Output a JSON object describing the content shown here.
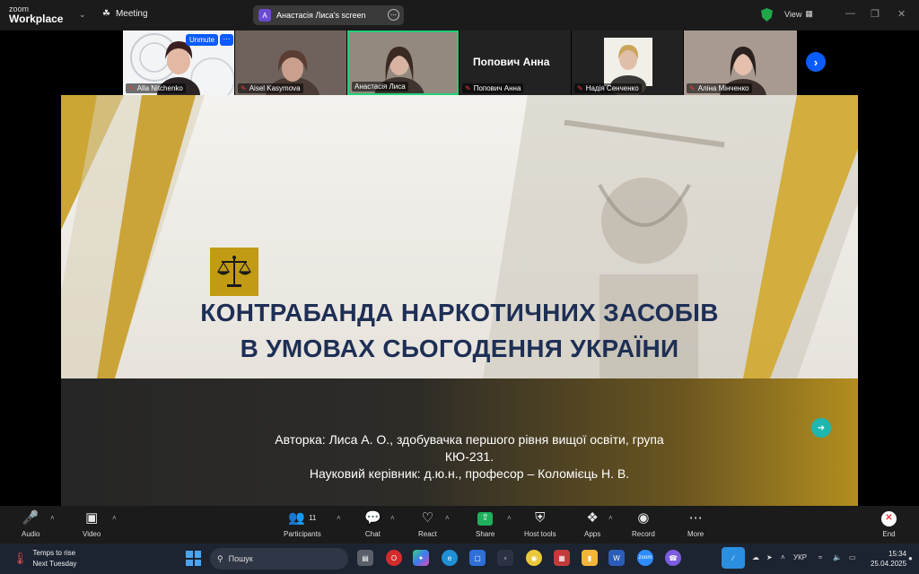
{
  "app": {
    "logo_line1": "zoom",
    "logo_line2": "Workplace",
    "meeting_label": "Meeting"
  },
  "screen_share": {
    "avatar_letter": "A",
    "label": "Анастасія Лиса's screen"
  },
  "view_label": "View",
  "gallery": {
    "participants": [
      {
        "name": "Alla Nitchenko",
        "muted": true,
        "unmute_label": "Unmute"
      },
      {
        "name": "Aisel Kasymova",
        "muted": true
      },
      {
        "name": "Анастасія Лиса",
        "muted": false,
        "active_speaker": true
      },
      {
        "name": "Попович Анна",
        "muted": true,
        "display_name_large": "Попович Анна"
      },
      {
        "name": "Надія Сенченко",
        "muted": true
      },
      {
        "name": "Аліна Мінченко",
        "muted": true
      }
    ]
  },
  "slide": {
    "title_line1": "КОНТРАБАНДА НАРКОТИЧНИХ ЗАСОБІВ",
    "title_line2": "В УМОВАХ СЬОГОДЕННЯ УКРАЇНИ",
    "body_line1": "Авторка: Лиса А. О., здобувачка першого рівня вищої освіти, група",
    "body_line2": "КЮ-231.",
    "body_line3": "Науковий керівник: д.ю.н., професор – Коломієць Н. В.",
    "accent_color": "#c29b14",
    "title_color": "#1e2f55"
  },
  "controls": {
    "audio": "Audio",
    "video": "Video",
    "participants": "Participants",
    "participants_count": "11",
    "chat": "Chat",
    "react": "React",
    "share": "Share",
    "host_tools": "Host tools",
    "apps": "Apps",
    "record": "Record",
    "more": "More",
    "end": "End"
  },
  "taskbar": {
    "weather_line1": "Temps to rise",
    "weather_line2": "Next Tuesday",
    "search_placeholder": "Пошук",
    "language": "УКР",
    "time": "15:34",
    "date": "25.04.2025"
  }
}
